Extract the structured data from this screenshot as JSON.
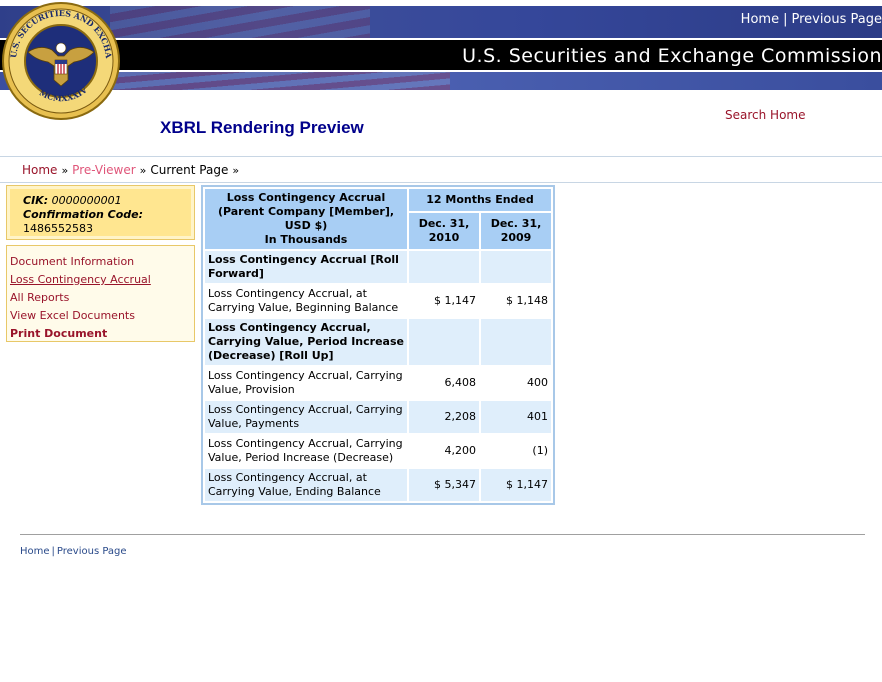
{
  "header": {
    "nav_home": "Home",
    "nav_separator": "|",
    "nav_previous": "Previous Page",
    "agency_title": "U.S. Securities and Exchange Commission",
    "seal_text": "U.S. SECURITIES AND EXCHANGE COMMISSION · MCMXXXIV"
  },
  "page": {
    "title": "XBRL Rendering Preview",
    "search_home": "Search Home"
  },
  "breadcrumb": {
    "home": "Home",
    "pre_viewer": "Pre-Viewer",
    "current": "Current Page",
    "separator": "»"
  },
  "sidebar": {
    "cik_label": "CIK:",
    "cik_value": "0000000001",
    "confirmation_label": "Confirmation Code:",
    "confirmation_value": "1486552583",
    "links": {
      "document_information": "Document Information",
      "loss_contingency_accrual": "Loss Contingency Accrual",
      "all_reports": "All Reports",
      "view_excel": "View Excel Documents",
      "print_document": "Print Document"
    }
  },
  "report": {
    "header_line1": "Loss Contingency Accrual (Parent Company [Member], USD $)",
    "header_line2": "In Thousands",
    "period_group": "12 Months Ended",
    "col1": "Dec. 31, 2010",
    "col2": "Dec. 31, 2009",
    "rows": [
      {
        "label": "Loss Contingency Accrual [Roll Forward]",
        "v1": "",
        "v2": ""
      },
      {
        "label": "Loss Contingency Accrual, at Carrying Value, Beginning Balance",
        "v1": "$ 1,147",
        "v2": "$ 1,148"
      },
      {
        "label": "Loss Contingency Accrual, Carrying Value, Period Increase (Decrease) [Roll Up]",
        "v1": "",
        "v2": ""
      },
      {
        "label": "Loss Contingency Accrual, Carrying Value, Provision",
        "v1": "6,408",
        "v2": "400"
      },
      {
        "label": "Loss Contingency Accrual, Carrying Value, Payments",
        "v1": "2,208",
        "v2": "401"
      },
      {
        "label": "Loss Contingency Accrual, Carrying Value, Period Increase (Decrease)",
        "v1": "4,200",
        "v2": "(1)"
      },
      {
        "label": "Loss Contingency Accrual, at Carrying Value, Ending Balance",
        "v1": "$ 5,347",
        "v2": "$ 1,147"
      }
    ]
  },
  "footer": {
    "home": "Home",
    "separator": "|",
    "previous": "Previous Page"
  },
  "colors": {
    "banner_blue": "#35479a",
    "link_red": "#99142a",
    "title_navy": "#00008b",
    "table_header_blue": "#a8cef4",
    "table_row_alt": "#dfeefb",
    "sidebar_yellow": "#ffe690"
  }
}
